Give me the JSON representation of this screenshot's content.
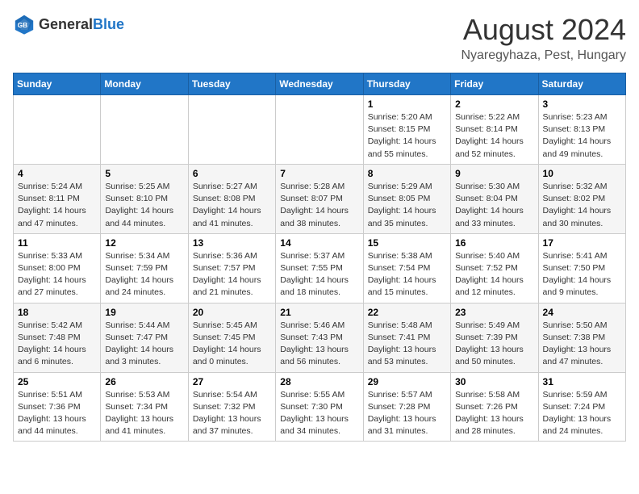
{
  "logo": {
    "general": "General",
    "blue": "Blue"
  },
  "header": {
    "month": "August 2024",
    "location": "Nyaregyhaza, Pest, Hungary"
  },
  "days_of_week": [
    "Sunday",
    "Monday",
    "Tuesday",
    "Wednesday",
    "Thursday",
    "Friday",
    "Saturday"
  ],
  "weeks": [
    [
      {
        "day": "",
        "info": ""
      },
      {
        "day": "",
        "info": ""
      },
      {
        "day": "",
        "info": ""
      },
      {
        "day": "",
        "info": ""
      },
      {
        "day": "1",
        "info": "Sunrise: 5:20 AM\nSunset: 8:15 PM\nDaylight: 14 hours\nand 55 minutes."
      },
      {
        "day": "2",
        "info": "Sunrise: 5:22 AM\nSunset: 8:14 PM\nDaylight: 14 hours\nand 52 minutes."
      },
      {
        "day": "3",
        "info": "Sunrise: 5:23 AM\nSunset: 8:13 PM\nDaylight: 14 hours\nand 49 minutes."
      }
    ],
    [
      {
        "day": "4",
        "info": "Sunrise: 5:24 AM\nSunset: 8:11 PM\nDaylight: 14 hours\nand 47 minutes."
      },
      {
        "day": "5",
        "info": "Sunrise: 5:25 AM\nSunset: 8:10 PM\nDaylight: 14 hours\nand 44 minutes."
      },
      {
        "day": "6",
        "info": "Sunrise: 5:27 AM\nSunset: 8:08 PM\nDaylight: 14 hours\nand 41 minutes."
      },
      {
        "day": "7",
        "info": "Sunrise: 5:28 AM\nSunset: 8:07 PM\nDaylight: 14 hours\nand 38 minutes."
      },
      {
        "day": "8",
        "info": "Sunrise: 5:29 AM\nSunset: 8:05 PM\nDaylight: 14 hours\nand 35 minutes."
      },
      {
        "day": "9",
        "info": "Sunrise: 5:30 AM\nSunset: 8:04 PM\nDaylight: 14 hours\nand 33 minutes."
      },
      {
        "day": "10",
        "info": "Sunrise: 5:32 AM\nSunset: 8:02 PM\nDaylight: 14 hours\nand 30 minutes."
      }
    ],
    [
      {
        "day": "11",
        "info": "Sunrise: 5:33 AM\nSunset: 8:00 PM\nDaylight: 14 hours\nand 27 minutes."
      },
      {
        "day": "12",
        "info": "Sunrise: 5:34 AM\nSunset: 7:59 PM\nDaylight: 14 hours\nand 24 minutes."
      },
      {
        "day": "13",
        "info": "Sunrise: 5:36 AM\nSunset: 7:57 PM\nDaylight: 14 hours\nand 21 minutes."
      },
      {
        "day": "14",
        "info": "Sunrise: 5:37 AM\nSunset: 7:55 PM\nDaylight: 14 hours\nand 18 minutes."
      },
      {
        "day": "15",
        "info": "Sunrise: 5:38 AM\nSunset: 7:54 PM\nDaylight: 14 hours\nand 15 minutes."
      },
      {
        "day": "16",
        "info": "Sunrise: 5:40 AM\nSunset: 7:52 PM\nDaylight: 14 hours\nand 12 minutes."
      },
      {
        "day": "17",
        "info": "Sunrise: 5:41 AM\nSunset: 7:50 PM\nDaylight: 14 hours\nand 9 minutes."
      }
    ],
    [
      {
        "day": "18",
        "info": "Sunrise: 5:42 AM\nSunset: 7:48 PM\nDaylight: 14 hours\nand 6 minutes."
      },
      {
        "day": "19",
        "info": "Sunrise: 5:44 AM\nSunset: 7:47 PM\nDaylight: 14 hours\nand 3 minutes."
      },
      {
        "day": "20",
        "info": "Sunrise: 5:45 AM\nSunset: 7:45 PM\nDaylight: 14 hours\nand 0 minutes."
      },
      {
        "day": "21",
        "info": "Sunrise: 5:46 AM\nSunset: 7:43 PM\nDaylight: 13 hours\nand 56 minutes."
      },
      {
        "day": "22",
        "info": "Sunrise: 5:48 AM\nSunset: 7:41 PM\nDaylight: 13 hours\nand 53 minutes."
      },
      {
        "day": "23",
        "info": "Sunrise: 5:49 AM\nSunset: 7:39 PM\nDaylight: 13 hours\nand 50 minutes."
      },
      {
        "day": "24",
        "info": "Sunrise: 5:50 AM\nSunset: 7:38 PM\nDaylight: 13 hours\nand 47 minutes."
      }
    ],
    [
      {
        "day": "25",
        "info": "Sunrise: 5:51 AM\nSunset: 7:36 PM\nDaylight: 13 hours\nand 44 minutes."
      },
      {
        "day": "26",
        "info": "Sunrise: 5:53 AM\nSunset: 7:34 PM\nDaylight: 13 hours\nand 41 minutes."
      },
      {
        "day": "27",
        "info": "Sunrise: 5:54 AM\nSunset: 7:32 PM\nDaylight: 13 hours\nand 37 minutes."
      },
      {
        "day": "28",
        "info": "Sunrise: 5:55 AM\nSunset: 7:30 PM\nDaylight: 13 hours\nand 34 minutes."
      },
      {
        "day": "29",
        "info": "Sunrise: 5:57 AM\nSunset: 7:28 PM\nDaylight: 13 hours\nand 31 minutes."
      },
      {
        "day": "30",
        "info": "Sunrise: 5:58 AM\nSunset: 7:26 PM\nDaylight: 13 hours\nand 28 minutes."
      },
      {
        "day": "31",
        "info": "Sunrise: 5:59 AM\nSunset: 7:24 PM\nDaylight: 13 hours\nand 24 minutes."
      }
    ]
  ]
}
